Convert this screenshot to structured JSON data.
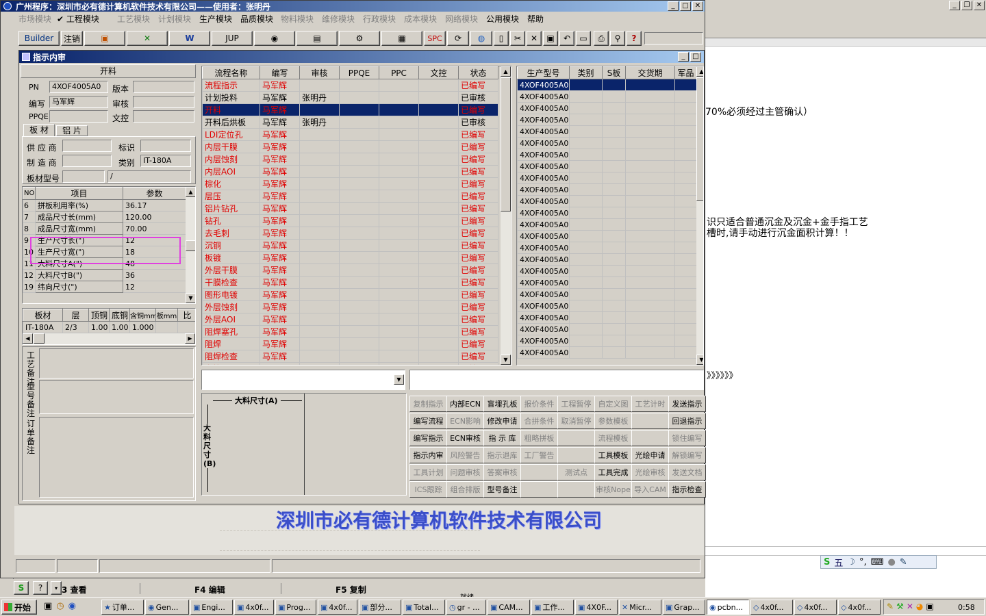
{
  "app": {
    "title": "广州程序：深圳市必有德计算机软件技术有限公司——使用者：张明丹"
  },
  "menu": [
    {
      "label": "市场模块",
      "enabled": false
    },
    {
      "label": "✔ 工程模块",
      "enabled": true
    },
    {
      "label": "工艺模块",
      "enabled": false
    },
    {
      "label": "计划模块",
      "enabled": false
    },
    {
      "label": "生产模块",
      "enabled": true
    },
    {
      "label": "品质模块",
      "enabled": true
    },
    {
      "label": "物料模块",
      "enabled": false
    },
    {
      "label": "维修模块",
      "enabled": false
    },
    {
      "label": "行政模块",
      "enabled": false
    },
    {
      "label": "成本模块",
      "enabled": false
    },
    {
      "label": "网络模块",
      "enabled": false
    },
    {
      "label": "公用模块",
      "enabled": true
    },
    {
      "label": "帮助",
      "enabled": true
    }
  ],
  "toolbar": {
    "builder": "Builder",
    "logout": "注销",
    "jup": "JUP",
    "spc": "SPC"
  },
  "window": {
    "title": "指示内审"
  },
  "kailiao": {
    "header": "开料",
    "pn_label": "PN",
    "pn_value": "4XOF4005A0",
    "version_label": "版本",
    "version_value": "",
    "author_label": "编写",
    "author_value": "马军辉",
    "review_label": "审核",
    "review_value": "",
    "ppqe_label": "PPQE",
    "ppqe_value": "",
    "wenkong_label": "文控",
    "wenkong_value": ""
  },
  "tabs": [
    "板 材",
    "铝 片"
  ],
  "material": {
    "supplier_label": "供 应 商",
    "supplier_value": "",
    "mark_label": "标识",
    "mark_value": "",
    "maker_label": "制 造 商",
    "maker_value": "",
    "type_label": "类别",
    "type_value": "IT-180A",
    "model_label": "板材型号",
    "model_value": "",
    "model_value2": "/"
  },
  "params": {
    "headers": [
      "NO",
      "项目",
      "参数"
    ],
    "rows": [
      [
        "6",
        "拼板利用率(%)",
        "36.17"
      ],
      [
        "7",
        "成品尺寸长(mm)",
        "120.00"
      ],
      [
        "8",
        "成品尺寸宽(mm)",
        "70.00"
      ],
      [
        "9",
        "生产尺寸长(\")",
        "12"
      ],
      [
        "10",
        "生产尺寸宽(\")",
        "18"
      ],
      [
        "11",
        "大料尺寸A(\")",
        "48"
      ],
      [
        "12",
        "大料尺寸B(\")",
        "36"
      ],
      [
        "19",
        "纬向尺寸(\")",
        "12"
      ]
    ]
  },
  "boardtable": {
    "headers": [
      "板材",
      "层",
      "顶铜",
      "底铜",
      "含铜mm",
      "板mm",
      "比"
    ],
    "rows": [
      [
        "IT-180A",
        "2/3",
        "1.00",
        "1.00",
        "1.000",
        "",
        ""
      ]
    ]
  },
  "remarks": {
    "craft": "工艺备注",
    "model": "型号备注",
    "order": "订单备注"
  },
  "flow": {
    "headers": [
      "流程名称",
      "编写",
      "审核",
      "PPQE",
      "PPC",
      "文控",
      "状态"
    ],
    "rows": [
      {
        "name": "流程指示",
        "author": "马军辉",
        "reviewer": "",
        "status": "已编写",
        "red": true
      },
      {
        "name": "计划投料",
        "author": "马军辉",
        "reviewer": "张明丹",
        "status": "已审核",
        "red": false
      },
      {
        "name": "开料",
        "author": "马军辉",
        "reviewer": "",
        "status": "已编写",
        "red": true,
        "selected": true
      },
      {
        "name": "开料后烘板",
        "author": "马军辉",
        "reviewer": "张明丹",
        "status": "已审核",
        "red": false
      },
      {
        "name": "LDI定位孔",
        "author": "马军辉",
        "reviewer": "",
        "status": "已编写",
        "red": true
      },
      {
        "name": "内层干膜",
        "author": "马军辉",
        "reviewer": "",
        "status": "已编写",
        "red": true
      },
      {
        "name": "内层蚀刻",
        "author": "马军辉",
        "reviewer": "",
        "status": "已编写",
        "red": true
      },
      {
        "name": "内层AOI",
        "author": "马军辉",
        "reviewer": "",
        "status": "已编写",
        "red": true
      },
      {
        "name": "棕化",
        "author": "马军辉",
        "reviewer": "",
        "status": "已编写",
        "red": true
      },
      {
        "name": "层压",
        "author": "马军辉",
        "reviewer": "",
        "status": "已编写",
        "red": true
      },
      {
        "name": "铝片钻孔",
        "author": "马军辉",
        "reviewer": "",
        "status": "已编写",
        "red": true
      },
      {
        "name": "钻孔",
        "author": "马军辉",
        "reviewer": "",
        "status": "已编写",
        "red": true
      },
      {
        "name": "去毛刺",
        "author": "马军辉",
        "reviewer": "",
        "status": "已编写",
        "red": true
      },
      {
        "name": "沉铜",
        "author": "马军辉",
        "reviewer": "",
        "status": "已编写",
        "red": true
      },
      {
        "name": "板镀",
        "author": "马军辉",
        "reviewer": "",
        "status": "已编写",
        "red": true
      },
      {
        "name": "外层干膜",
        "author": "马军辉",
        "reviewer": "",
        "status": "已编写",
        "red": true
      },
      {
        "name": "干膜检查",
        "author": "马军辉",
        "reviewer": "",
        "status": "已编写",
        "red": true
      },
      {
        "name": "图形电镀",
        "author": "马军辉",
        "reviewer": "",
        "status": "已编写",
        "red": true
      },
      {
        "name": "外层蚀刻",
        "author": "马军辉",
        "reviewer": "",
        "status": "已编写",
        "red": true
      },
      {
        "name": "外层AOI",
        "author": "马军辉",
        "reviewer": "",
        "status": "已编写",
        "red": true
      },
      {
        "name": "阻焊塞孔",
        "author": "马军辉",
        "reviewer": "",
        "status": "已编写",
        "red": true
      },
      {
        "name": "阻焊",
        "author": "马军辉",
        "reviewer": "",
        "status": "已编写",
        "red": true
      },
      {
        "name": "阻焊检查",
        "author": "马军辉",
        "reviewer": "",
        "status": "已编写",
        "red": true
      },
      {
        "name": "字符",
        "author": "马军辉",
        "reviewer": "",
        "status": "已编写",
        "red": true
      }
    ]
  },
  "models": {
    "headers": [
      "生产型号",
      "类别",
      "S板",
      "交货期",
      "军品"
    ],
    "rows": [
      "4XOF4005A0",
      "4XOF4005A0",
      "4XOF4005A0",
      "4XOF4005A0",
      "4XOF4005A0",
      "4XOF4005A0",
      "4XOF4005A0",
      "4XOF4005A0",
      "4XOF4005A0",
      "4XOF4005A0",
      "4XOF4005A0",
      "4XOF4005A0",
      "4XOF4005A0",
      "4XOF4005A0",
      "4XOF4005A0",
      "4XOF4005A0",
      "4XOF4005A0",
      "4XOF4005A0",
      "4XOF4005A0",
      "4XOF4005A0",
      "4XOF4005A0",
      "4XOF4005A0",
      "4XOF4005A0",
      "4XOF4005A0"
    ]
  },
  "diagram": {
    "a_label": "大料尺寸(A)",
    "b_label": "大料尺寸(B)"
  },
  "actions": [
    [
      "复制指示",
      "内部ECN",
      "盲埋孔板",
      "报价条件",
      "工程暂停",
      "自定义图",
      "工艺计时",
      "发送指示"
    ],
    [
      "编写流程",
      "ECN影响",
      "修改申请",
      "合拼条件",
      "取消暂停",
      "参数模板",
      "",
      "回退指示"
    ],
    [
      "编写指示",
      "ECN审核",
      "指 示 库",
      "粗略拼板",
      "",
      "流程模板",
      "",
      "锁住编写"
    ],
    [
      "指示内审",
      "风险警告",
      "指示退库",
      "工厂警告",
      "",
      "工具模板",
      "光绘申请",
      "解锁编写"
    ],
    [
      "工具计划",
      "问题审核",
      "答案审核",
      "",
      "测试点",
      "工具完成",
      "光绘审核",
      "发送文档"
    ],
    [
      "ICS跟踪",
      "组合排版",
      "型号备注",
      "",
      "",
      "审核Nope",
      "导入CAM",
      "指示检查"
    ]
  ],
  "actions_enabled": [
    [
      false,
      true,
      true,
      false,
      false,
      false,
      false,
      true
    ],
    [
      true,
      false,
      true,
      false,
      false,
      false,
      false,
      true
    ],
    [
      true,
      true,
      true,
      false,
      false,
      false,
      false,
      false
    ],
    [
      true,
      false,
      false,
      false,
      false,
      true,
      true,
      false
    ],
    [
      false,
      false,
      false,
      false,
      false,
      true,
      false,
      false
    ],
    [
      false,
      false,
      true,
      false,
      false,
      false,
      false,
      true
    ]
  ],
  "company": "深圳市必有德计算机软件技术有限公司",
  "fkeys": [
    "3 查看",
    "F4 编辑",
    "F5 复制",
    "就绪"
  ],
  "bgdoc": {
    "line1": "70%必须经过主管确认）",
    "line2": "识只适合普通沉金及沉金+金手指工艺",
    "line3": "槽时,请手动进行沉金面积计算！！",
    "line4": "》》》》》》"
  },
  "left_strip": [
    "[-(",
    "文",
    "选"
  ],
  "taskbar": {
    "start": "开始",
    "items": [
      "订单...",
      "Gen...",
      "Engi...",
      "4x0f...",
      "Prog...",
      "4x0f...",
      "部分...",
      "Total...",
      "gr - ...",
      "CAM...",
      "工作...",
      "4X0F...",
      "Micr...",
      "Grap...",
      "pcbn...",
      "4x0f...",
      "4x0f...",
      "4x0f..."
    ],
    "clock": "0:58"
  },
  "ime": {
    "label": "五"
  },
  "colors": {
    "title_start": "#0a246a",
    "title_end": "#a6caf0",
    "selected_row": "#0a246a",
    "red_text": "#e00000",
    "highlight_box": "#e040e0"
  }
}
